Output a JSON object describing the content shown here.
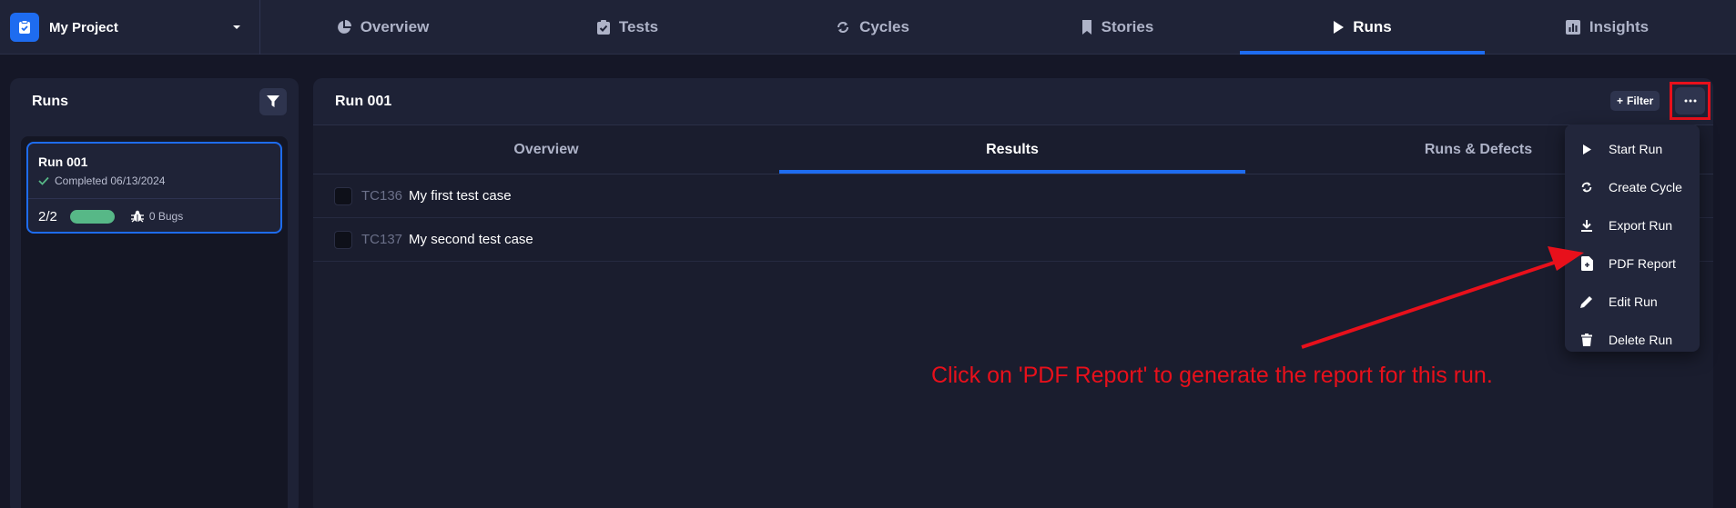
{
  "project": {
    "name": "My Project"
  },
  "nav": {
    "tabs": [
      {
        "label": "Overview",
        "icon": "pie-chart-icon"
      },
      {
        "label": "Tests",
        "icon": "clipboard-check-icon"
      },
      {
        "label": "Cycles",
        "icon": "cycle-icon"
      },
      {
        "label": "Stories",
        "icon": "bookmark-icon"
      },
      {
        "label": "Runs",
        "icon": "play-icon",
        "active": true
      },
      {
        "label": "Insights",
        "icon": "bar-chart-icon"
      }
    ]
  },
  "sidebar": {
    "title": "Runs",
    "runs": [
      {
        "name": "Run 001",
        "status": "Completed 06/13/2024",
        "count": "2/2",
        "progress": 1.0,
        "bugs": "0 Bugs"
      }
    ]
  },
  "main": {
    "title": "Run 001",
    "filter_label": "Filter",
    "tabs": [
      {
        "label": "Overview"
      },
      {
        "label": "Results",
        "active": true
      },
      {
        "label": "Runs & Defects"
      }
    ],
    "test_cases": [
      {
        "id": "TC136",
        "name": "My first test case"
      },
      {
        "id": "TC137",
        "name": "My second test case"
      }
    ]
  },
  "menu": {
    "items": [
      {
        "label": "Start Run",
        "icon": "play-icon"
      },
      {
        "label": "Create Cycle",
        "icon": "cycle-icon"
      },
      {
        "label": "Export Run",
        "icon": "download-icon"
      },
      {
        "label": "PDF Report",
        "icon": "pdf-file-icon"
      },
      {
        "label": "Edit Run",
        "icon": "pencil-icon"
      },
      {
        "label": "Delete Run",
        "icon": "trash-icon"
      }
    ]
  },
  "annotation": {
    "text": "Click on 'PDF Report' to generate the report for this run."
  },
  "colors": {
    "accent": "#1e6cf0",
    "annotation": "#e8101b",
    "progress": "#57b887"
  }
}
